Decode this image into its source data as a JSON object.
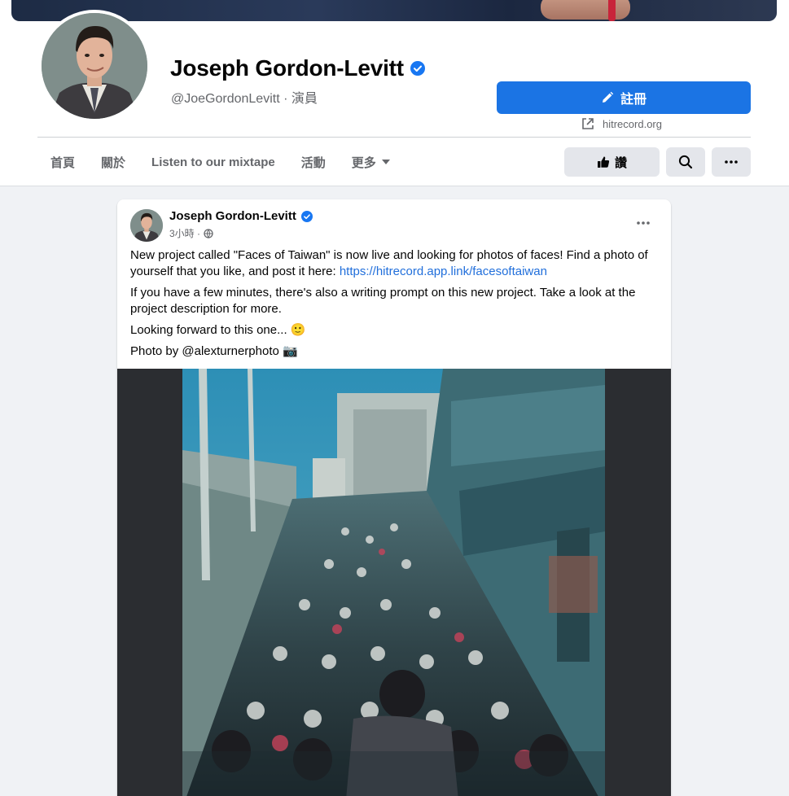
{
  "profile": {
    "name": "Joseph Gordon-Levitt",
    "handle": "@JoeGordonLevitt · 演員",
    "cta_label": "註冊",
    "website": "hitrecord.org"
  },
  "tabs": [
    "首頁",
    "關於",
    "Listen to our mixtape",
    "活動",
    "更多"
  ],
  "actions": {
    "like_label": "讚"
  },
  "post": {
    "author": "Joseph Gordon-Levitt",
    "time": "3小時 ·",
    "text1": "New project called \"Faces of Taiwan\" is now live and looking for photos of faces! Find a photo of yourself that you like, and post it here: ",
    "link": "https://hitrecord.app.link/facesoftaiwan",
    "text2": "If you have a few minutes, there's also a writing prompt on this new project. Take a look at the project description for more.",
    "text3": "Looking forward to this one... 🙂",
    "text4": "Photo by @alexturnerphoto 📷"
  },
  "colors": {
    "brand": "#1b74e4",
    "verified": "#1877f2",
    "link": "#216fdb"
  }
}
